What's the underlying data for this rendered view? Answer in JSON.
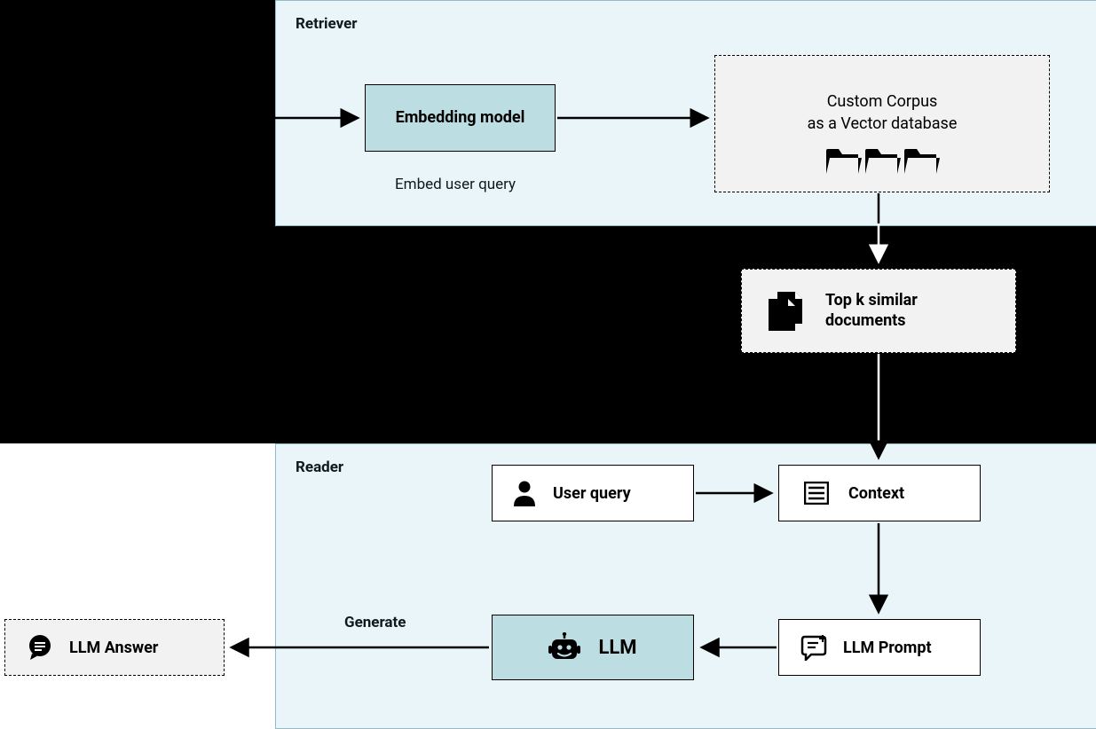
{
  "retriever": {
    "title": "Retriever",
    "embedding_label": "Embedding model",
    "embed_caption": "Embed user query",
    "corpus_line1": "Custom Corpus",
    "corpus_line2": "as a Vector database",
    "topk_label": "Top k similar documents"
  },
  "reader": {
    "title": "Reader",
    "user_query_label": "User query",
    "context_label": "Context",
    "llm_prompt_label": "LLM Prompt",
    "llm_label": "LLM",
    "generate_label": "Generate",
    "answer_label": "LLM Answer"
  }
}
